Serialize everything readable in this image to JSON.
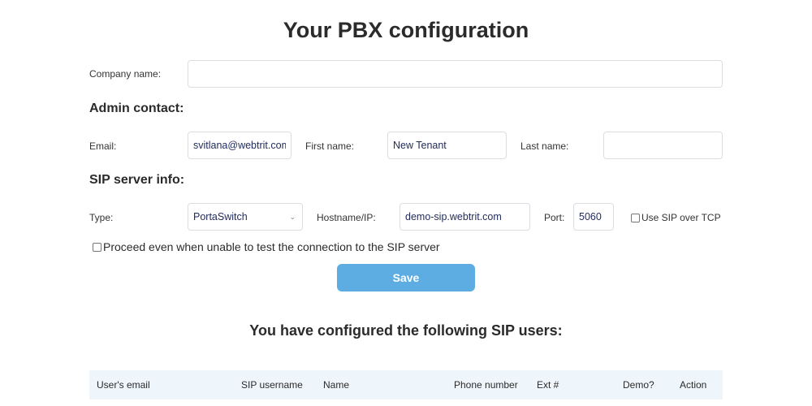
{
  "page": {
    "title": "Your PBX configuration"
  },
  "company": {
    "label": "Company name:",
    "value": ""
  },
  "admin_contact": {
    "section_title": "Admin contact:",
    "email_label": "Email:",
    "email_value": "svitlana@webtrit.com",
    "first_name_label": "First name:",
    "first_name_value": "New Tenant",
    "last_name_label": "Last name:",
    "last_name_value": ""
  },
  "sip_server": {
    "section_title": "SIP server info:",
    "type_label": "Type:",
    "type_value": "PortaSwitch",
    "type_icon": "chevron-down-icon",
    "hostname_label": "Hostname/IP:",
    "hostname_value": "demo-sip.webtrit.com",
    "port_label": "Port:",
    "port_value": "5060",
    "tcp_label": "Use SIP over TCP",
    "tcp_checked": false,
    "proceed_label": "Proceed even when unable to test the connection to the SIP server",
    "proceed_checked": false
  },
  "actions": {
    "save_label": "Save",
    "save_color": "#5dade2"
  },
  "sip_users": {
    "title": "You have configured the following SIP users:",
    "columns": [
      "User's email",
      "SIP username",
      "Name",
      "Phone number",
      "Ext #",
      "Demo?",
      "Action"
    ],
    "header_bg": "#eef5fb"
  }
}
